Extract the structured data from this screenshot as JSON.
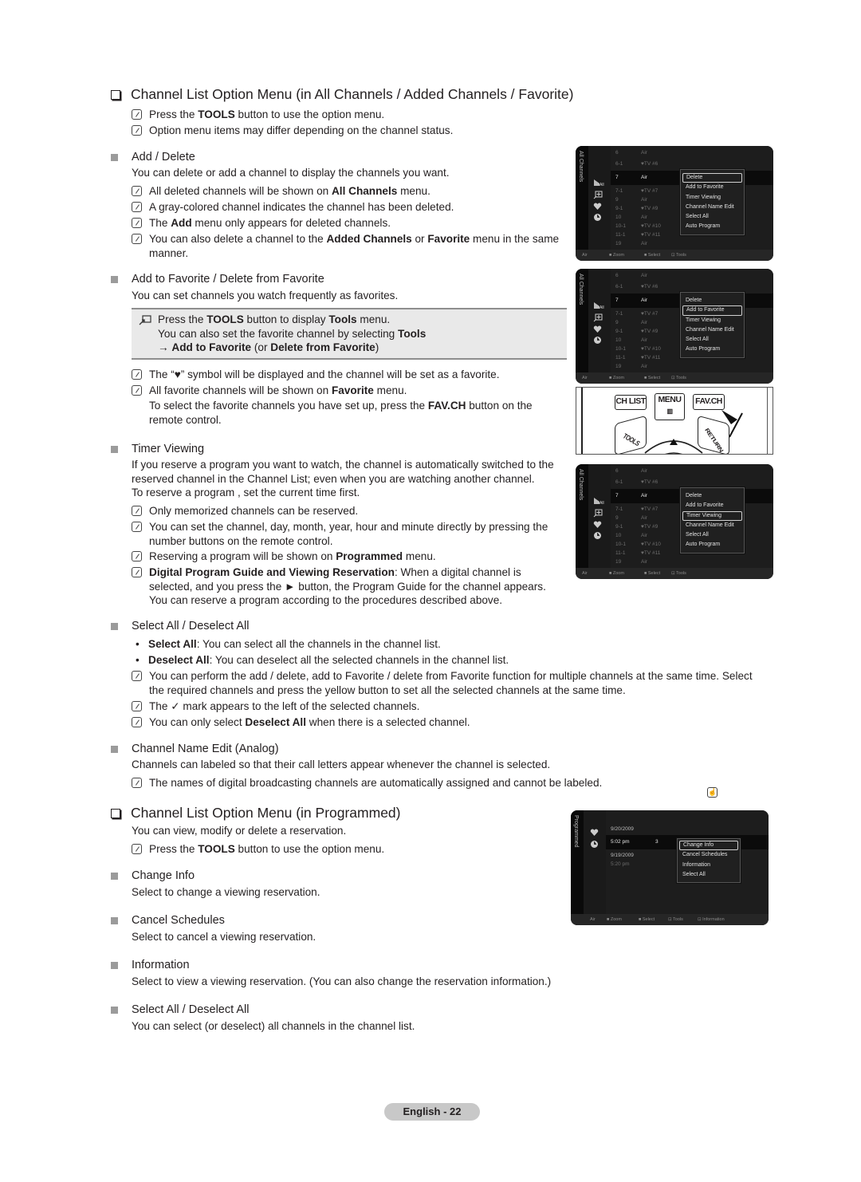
{
  "section1": {
    "title": "Channel List Option Menu (in All Channels / Added Channels / Favorite)",
    "notes": [
      {
        "pre": "Press the ",
        "bold": "TOOLS",
        "post": " button to use the option menu."
      },
      {
        "pre": "Option menu items may differ depending on the channel status.",
        "bold": "",
        "post": ""
      }
    ]
  },
  "add_delete": {
    "heading": "Add / Delete",
    "desc": "You can delete or add a channel to display the channels you want.",
    "notes": [
      {
        "pre": "All deleted channels will be shown on ",
        "bold": "All Channels",
        "post": " menu."
      },
      {
        "pre": "A gray-colored channel indicates the channel has been deleted.",
        "bold": "",
        "post": ""
      },
      {
        "pre": "The ",
        "bold": "Add",
        "post": " menu only appears for deleted channels."
      },
      {
        "pre": "You can also delete a channel to the ",
        "bold": "Added Channels",
        "mid": " or ",
        "bold2": "Favorite",
        "post": " menu in the same",
        "line2": "manner."
      }
    ]
  },
  "favorite": {
    "heading": "Add to Favorite / Delete from Favorite",
    "desc": "You can set channels you watch frequently as favorites.",
    "tip": {
      "line1_pre": "Press the ",
      "line1_b1": "TOOLS",
      "line1_mid": " button to display ",
      "line1_b2": "Tools",
      "line1_post": " menu.",
      "line2_pre": "You can also set the favorite channel by selecting ",
      "line2_b": "Tools",
      "line3_arrow": "→ ",
      "line3_b1": "Add to Favorite",
      "line3_mid": " (or ",
      "line3_b2": "Delete from Favorite",
      "line3_post": ")"
    },
    "notes": [
      {
        "pre": "The “♥” symbol will be displayed and the channel will be set as a favorite.",
        "bold": "",
        "post": ""
      },
      {
        "pre": "All favorite channels will be shown on ",
        "bold": "Favorite",
        "post": " menu."
      }
    ],
    "remote_note": {
      "pre": "To select the favorite channels you have set up, press the ",
      "bold": "FAV.CH",
      "post": " button on the",
      "line2": "remote control."
    }
  },
  "timer": {
    "heading": "Timer Viewing",
    "desc": [
      "If you reserve a program you want to watch, the channel is automatically switched to the",
      "reserved channel in the Channel List; even when you are watching another channel.",
      "To reserve a program , set the current time first."
    ],
    "notes": [
      {
        "text": "Only memorized channels can be reserved."
      },
      {
        "text": "You can set the channel, day, month, year, hour and minute directly by pressing the",
        "line2": "number buttons on the remote control."
      },
      {
        "pre": "Reserving a program will be shown on ",
        "bold": "Programmed",
        "post": " menu."
      },
      {
        "bold": "Digital Program Guide and Viewing Reservation",
        "post": ": When a digital channel is",
        "line2": "selected, and you press the ► button, the Program Guide for the channel appears.",
        "line3": "You can reserve a program according to the procedures described above."
      }
    ]
  },
  "select_all": {
    "heading": "Select All / Deselect All",
    "bullets": [
      {
        "bold": "Select All",
        "post": ": You can select all the channels in the channel list."
      },
      {
        "bold": "Deselect All",
        "post": ": You can deselect all the selected channels in the channel list."
      }
    ],
    "notes": [
      {
        "text": "You can perform the add / delete, add to Favorite / delete from Favorite function for multiple channels at the same time. Select",
        "line2": "the required channels and press the yellow button to set all the selected channels at the same time."
      },
      {
        "pre": "The ",
        "check": "✓",
        "post": " mark appears to the left of the selected channels."
      },
      {
        "pre": "You can only select ",
        "bold": "Deselect All",
        "post": " when there is a selected channel."
      }
    ]
  },
  "name_edit": {
    "heading": "Channel Name Edit (Analog)",
    "desc": "Channels can labeled so that their call letters appear whenever the channel is selected.",
    "note": "The names of digital broadcasting channels are automatically assigned and cannot be labeled."
  },
  "section2": {
    "title": "Channel List Option Menu (in Programmed)",
    "desc": "You can view, modify or delete a reservation.",
    "note": {
      "pre": "Press the ",
      "bold": "TOOLS",
      "post": " button to use the option menu."
    }
  },
  "change_info": {
    "heading": "Change Info",
    "desc": "Select to change a viewing reservation."
  },
  "cancel_sched": {
    "heading": "Cancel Schedules",
    "desc": "Select to cancel a viewing reservation."
  },
  "information": {
    "heading": "Information",
    "desc": "Select to view a viewing reservation. (You can also change the reservation information.)"
  },
  "select_all2": {
    "heading": "Select All / Deselect All",
    "desc": "You can select (or deselect) all channels in the channel list."
  },
  "tv_channels": {
    "side_label": "All Channels",
    "rows": [
      {
        "num": "6",
        "name": "Air"
      },
      {
        "num": "6-1",
        "name": "♥TV #6"
      },
      {
        "num": "7",
        "name": "Air",
        "selected": true
      },
      {
        "num": "7-1",
        "name": "♥TV #7"
      },
      {
        "num": "9",
        "name": "Air"
      },
      {
        "num": "9-1",
        "name": "♥TV #9"
      },
      {
        "num": "10",
        "name": "Air"
      },
      {
        "num": "10-1",
        "name": "♥TV #10"
      },
      {
        "num": "11-1",
        "name": "♥TV #11"
      },
      {
        "num": "19",
        "name": "Air"
      }
    ],
    "menu": [
      "Delete",
      "Add to Favorite",
      "Timer Viewing",
      "Channel Name Edit",
      "Select All",
      "Auto Program"
    ],
    "highlighted": [
      0,
      1,
      2
    ],
    "footer": [
      "Air",
      "■ Zoom",
      "■ Select",
      "⊡ Tools"
    ]
  },
  "tv_programmed": {
    "side_label": "Programmed",
    "rows": [
      {
        "date": "9/20/2009",
        "time": "",
        "ch": ""
      },
      {
        "date": "5:02 pm",
        "time": "",
        "ch": "3",
        "selected": true
      },
      {
        "date": "9/19/2009",
        "time": "",
        "ch": ""
      },
      {
        "date": "5:20 pm",
        "time": "",
        "ch": "",
        "dim": true
      }
    ],
    "menu": [
      "Change Info",
      "Cancel Schedules",
      "Information",
      "Select All"
    ],
    "highlighted": 0,
    "footer": [
      "Air",
      "■ Zoom",
      "■ Select",
      "⊡ Tools",
      "⊡ Information"
    ]
  },
  "remote": {
    "buttons": [
      "CH LIST",
      "MENU",
      "FAV.CH",
      "TOOLS",
      "RETURN"
    ]
  },
  "page_footer": "English - 22"
}
